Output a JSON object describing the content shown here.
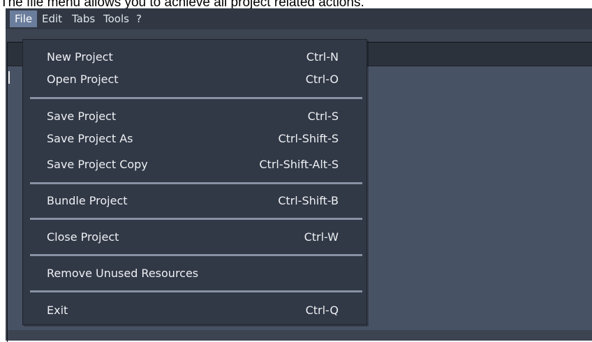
{
  "caption": "The file menu allows you to achieve all project related actions.",
  "menubar": {
    "items": [
      {
        "label": "File",
        "active": true
      },
      {
        "label": "Edit"
      },
      {
        "label": "Tabs"
      },
      {
        "label": "Tools"
      },
      {
        "label": "?"
      }
    ]
  },
  "file_menu": {
    "items": [
      {
        "label": "New Project",
        "shortcut": "Ctrl-N"
      },
      {
        "label": "Open Project",
        "shortcut": "Ctrl-O"
      },
      {
        "label": "Save Project",
        "shortcut": "Ctrl-S"
      },
      {
        "label": "Save Project As",
        "shortcut": "Ctrl-Shift-S"
      },
      {
        "label": "Save Project Copy",
        "shortcut": "Ctrl-Shift-Alt-S"
      },
      {
        "label": "Bundle Project",
        "shortcut": "Ctrl-Shift-B"
      },
      {
        "label": "Close Project",
        "shortcut": "Ctrl-W"
      },
      {
        "label": "Remove Unused Resources",
        "shortcut": ""
      },
      {
        "label": "Exit",
        "shortcut": "Ctrl-Q"
      }
    ]
  },
  "colors": {
    "menu_background": "#313846",
    "menubar_active": "#6b7d9c",
    "separator": "#8892a3",
    "workspace_content": "#485265",
    "text": "#eef0f3"
  }
}
